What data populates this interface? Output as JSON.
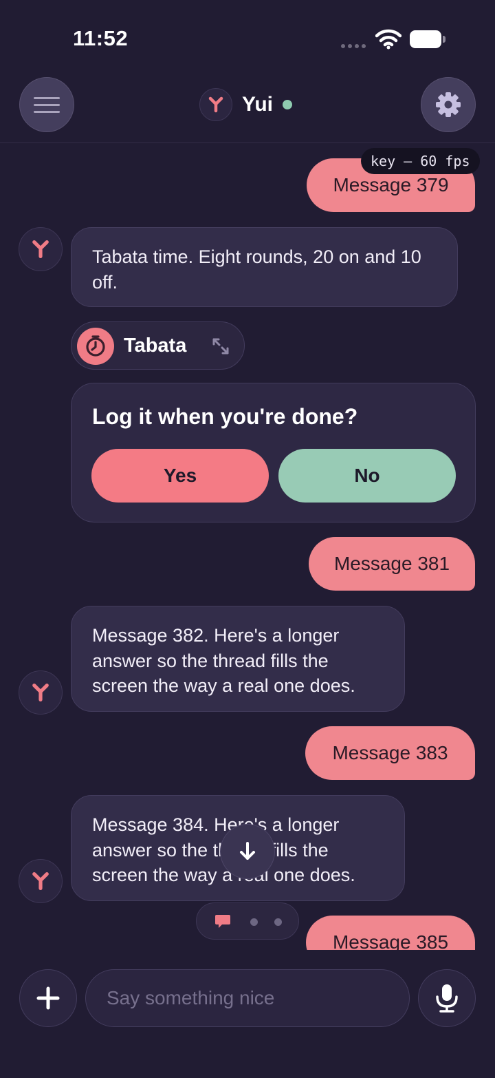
{
  "status_bar": {
    "time": "11:52"
  },
  "header": {
    "assistant_name": "Yui",
    "online": true
  },
  "perf_badge": "key – 60 fps",
  "messages": {
    "m379": "Message 379",
    "m380": "Tabata time. Eight rounds, 20 on and 10 off.",
    "tool_chip": "Tabata",
    "card_question": "Log it when you're done?",
    "card_yes": "Yes",
    "card_no": "No",
    "m381": "Message 381",
    "m382": "Message 382. Here's a longer answer so the thread fills the screen the way a real one does.",
    "m383": "Message 383",
    "m384": "Message 384. Here's a longer answer so the thread fills the screen the way a real one does.",
    "m385": "Message 385"
  },
  "composer": {
    "placeholder": "Say something nice"
  },
  "icons": {
    "menu": "hamburger-icon",
    "settings": "gear-icon",
    "avatar": "y-logo-icon",
    "tool": "timer-icon",
    "expand": "expand-arrows-icon",
    "scroll": "arrow-down-icon",
    "typing": "chat-bubble-icon",
    "add": "plus-icon",
    "mic": "microphone-icon"
  },
  "colors": {
    "background": "#211c33",
    "user_bubble": "#f0878f",
    "bot_bubble": "#332d4a",
    "accent_pink": "#f47b85",
    "accent_green": "#98cbb5",
    "online": "#8fcbb0"
  }
}
